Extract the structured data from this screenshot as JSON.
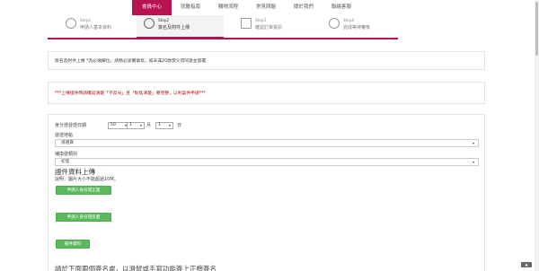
{
  "nav": {
    "items": [
      "會員中心",
      "就醫指南",
      "購物流程",
      "常見問題",
      "關於我們",
      "聯絡客服"
    ],
    "active_index": 0,
    "accent": "#b7134f"
  },
  "steps": [
    {
      "num": "Step1",
      "label": "申請人基本資料",
      "icon": "person-icon"
    },
    {
      "num": "Step2",
      "label": "簽名及附件上傳",
      "icon": "upload-icon"
    },
    {
      "num": "Step3",
      "label": "確認訂單資訊",
      "icon": "document-icon"
    },
    {
      "num": "Step4",
      "label": "完成等待審核",
      "icon": "clock-icon"
    }
  ],
  "active_step": 1,
  "notice1": "簽名及附件上傳 *為必填欄位，請務必詳實填寫，如未滿20歲需父母同意並簽署",
  "notice2": "***上傳證件時請確認清楚「不反光」且「對焦清楚」要完整，以利案件申請***",
  "form": {
    "birth_label": "身分證發證日期",
    "year_value": "50",
    "year_unit": "年",
    "month_value": "1",
    "month_unit": "月",
    "day_value": "1",
    "day_unit": "日",
    "place_label": "發證地點",
    "place_value": "請選擇",
    "type_label": "補換發類別",
    "type_value": "初發",
    "upload_title": "證件資料上傳",
    "upload_note": "說明：圖片大小不能超過10M。",
    "btn_front": "申請人身份證正面",
    "btn_back": "申請人身份證反面",
    "btn_other": "補件資料",
    "signature_text": "請於下面兩個簽名處，以滑鼠或手寫功能簽上正楷簽名"
  },
  "float_icon": "top-arrow-icon"
}
